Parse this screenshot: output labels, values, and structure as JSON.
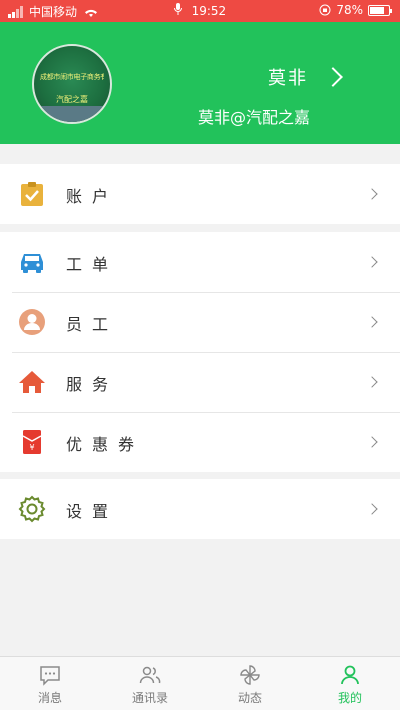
{
  "status": {
    "carrier": "中国移动",
    "time": "19:52",
    "battery": "78%",
    "battery_level": 0.78
  },
  "profile": {
    "name": "莫非",
    "subtitle": "莫非@汽配之嘉",
    "avatar_text_top": "成都市闹市电子商务有限公司",
    "avatar_text_mid": "汽配之嘉"
  },
  "menu": {
    "account": "账户",
    "work_order": "工单",
    "staff": "员工",
    "service": "服务",
    "coupon": "优惠券",
    "settings": "设置"
  },
  "tabs": [
    {
      "label": "消息",
      "icon": "message-icon"
    },
    {
      "label": "通讯录",
      "icon": "contacts-icon"
    },
    {
      "label": "动态",
      "icon": "pinwheel-icon"
    },
    {
      "label": "我的",
      "icon": "person-icon"
    }
  ],
  "colors": {
    "brand_green": "#22c25b",
    "status_red": "#ee4a43",
    "account_icon": "#e9b23c",
    "work_order_icon": "#2e8fd6",
    "staff_icon": "#e8a07b",
    "service_icon": "#e65a3a",
    "coupon_icon": "#e53a2f",
    "settings_icon": "#6a8a2e"
  }
}
